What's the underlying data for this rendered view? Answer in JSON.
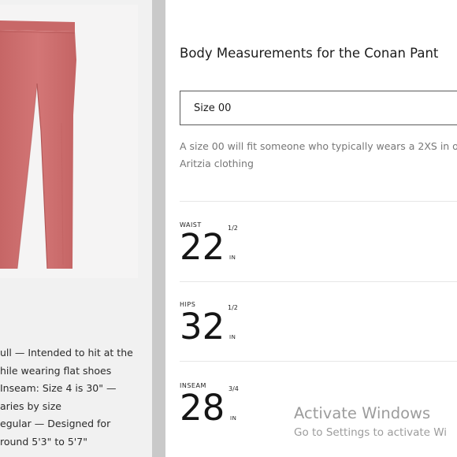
{
  "product_image": {
    "alt": "Conan Pant",
    "color": "#cd6e6e"
  },
  "fit_notes": [
    "ull — Intended to hit at the",
    "hile wearing flat shoes",
    " Inseam: Size 4 is 30\" —",
    "aries by size",
    "egular — Designed for",
    "round 5'3\" to 5'7\""
  ],
  "panel": {
    "title": "Body Measurements for the Conan Pant",
    "size_select": {
      "value": "Size 00"
    },
    "description_lines": [
      "A size 00 will fit someone who typically wears a 2XS in o",
      "Aritzia clothing"
    ],
    "measurements": [
      {
        "label": "WAIST",
        "value": "22",
        "fraction": "1/2",
        "unit": "IN"
      },
      {
        "label": "HIPS",
        "value": "32",
        "fraction": "1/2",
        "unit": "IN"
      },
      {
        "label": "INSEAM",
        "value": "28",
        "fraction": "3/4",
        "unit": "IN"
      }
    ]
  },
  "watermark": {
    "title": "Activate Windows",
    "subtitle": "Go to Settings to activate Wi"
  }
}
